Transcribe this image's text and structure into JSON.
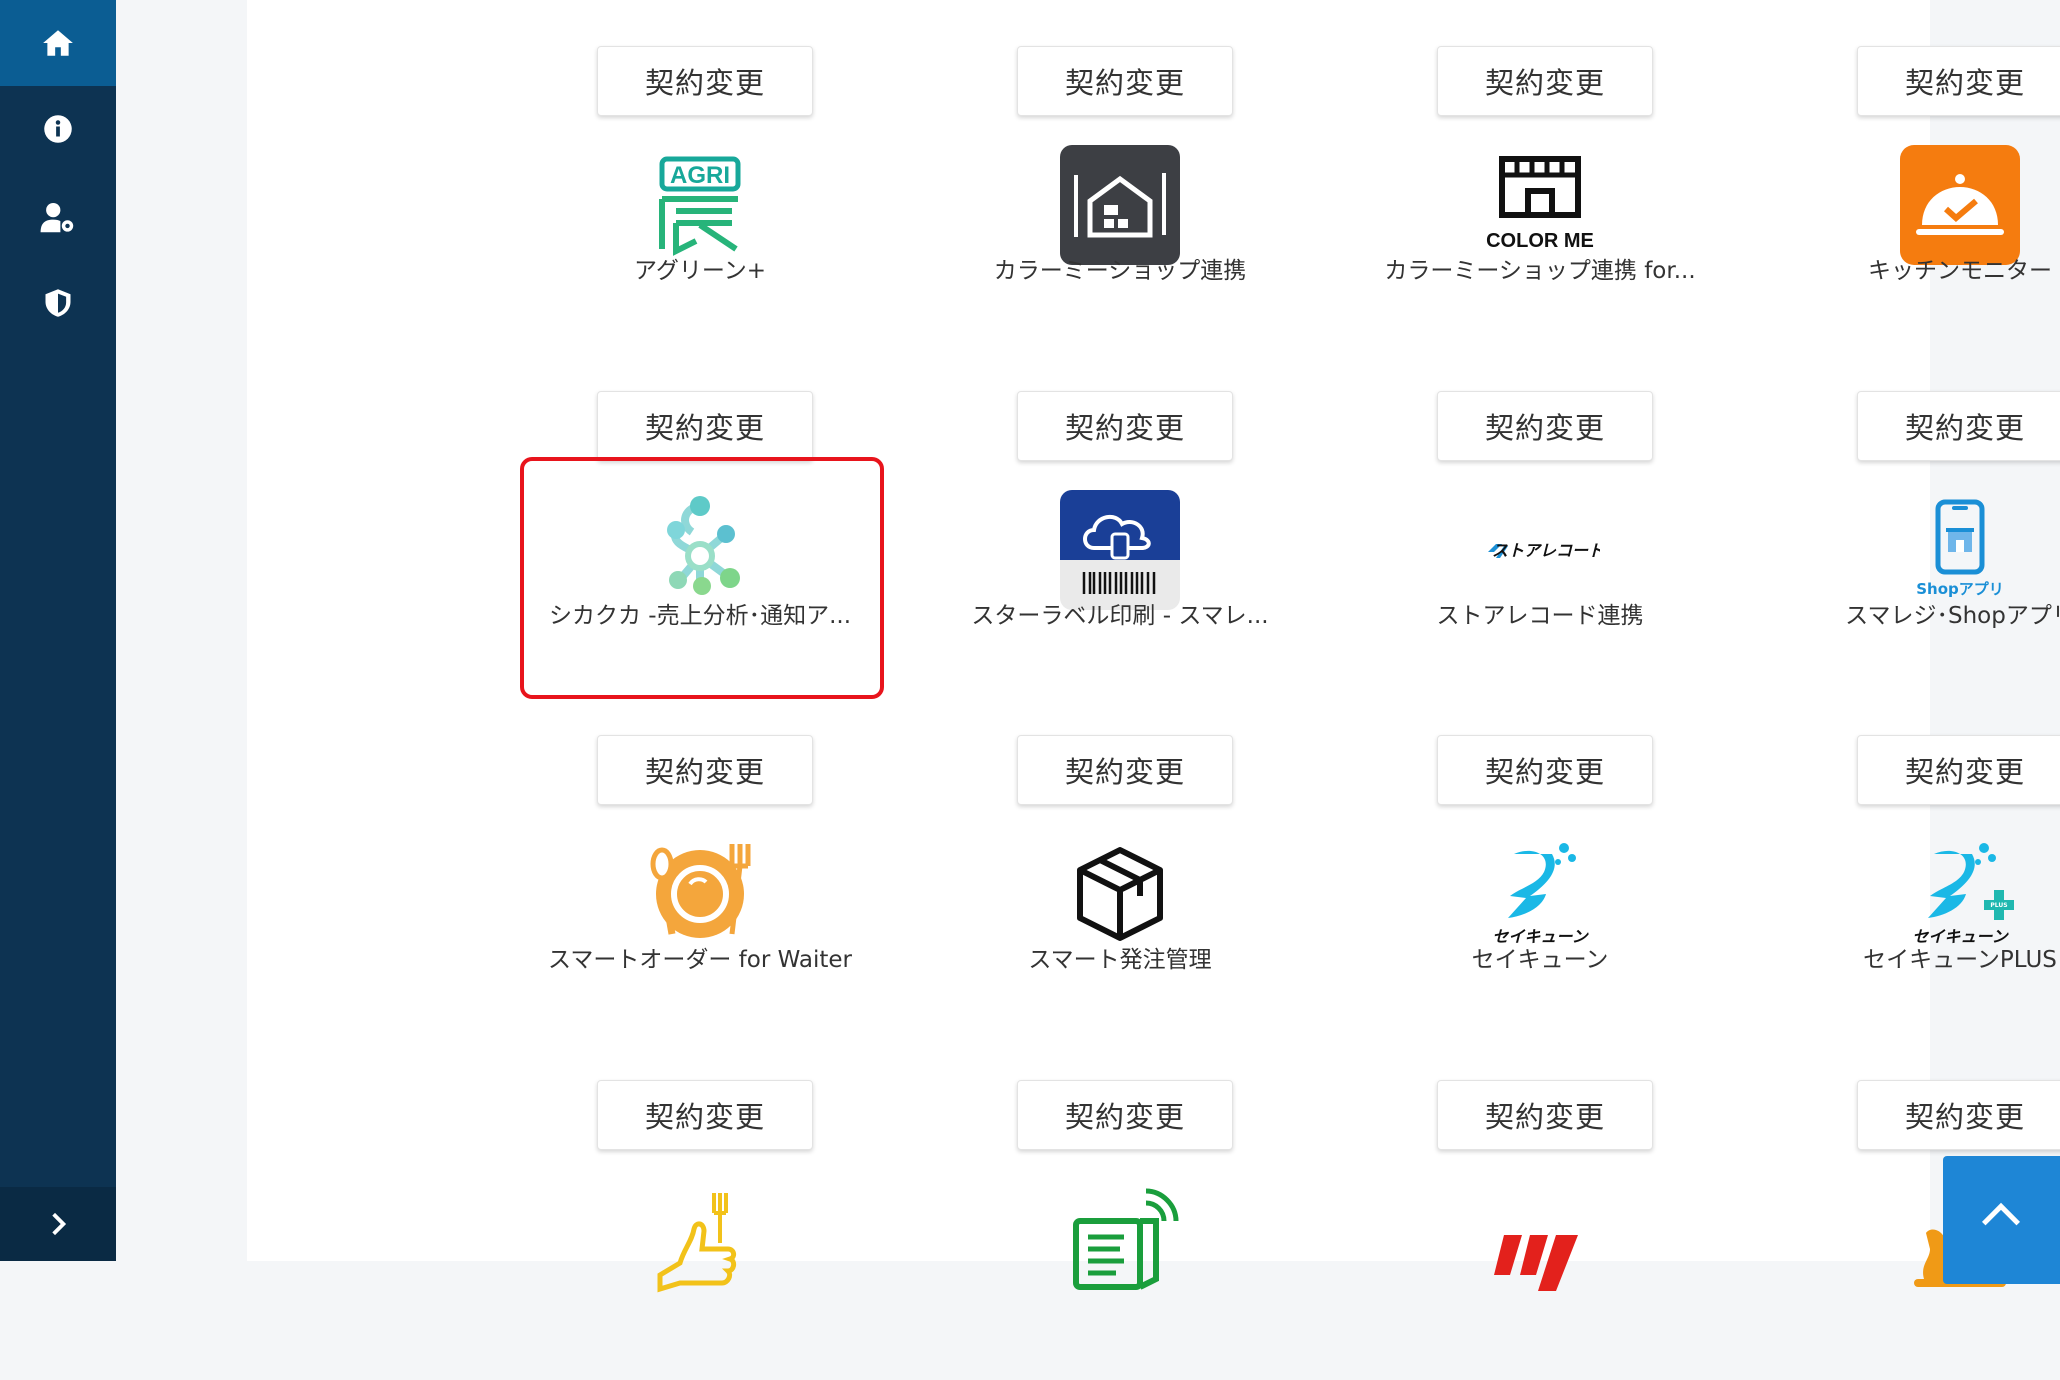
{
  "sidebar": {
    "items": [
      {
        "icon": "home-icon",
        "active": true
      },
      {
        "icon": "info-icon",
        "active": false
      },
      {
        "icon": "user-settings-icon",
        "active": false
      },
      {
        "icon": "shield-icon",
        "active": false
      }
    ],
    "footer_icon": "chevron-right-icon"
  },
  "apps": [
    {
      "button": "契約変更",
      "name": "アグリーン+",
      "logo_text": "AGRI"
    },
    {
      "button": "契約変更",
      "name": "カラーミーショップ連携"
    },
    {
      "button": "契約変更",
      "name": "カラーミーショップ連携 for...",
      "logo_text": "COLOR ME"
    },
    {
      "button": "契約変更",
      "name": "キッチンモニター"
    },
    {
      "button": "契約変更",
      "name": "シカクカ -売上分析･通知ア..."
    },
    {
      "button": "契約変更",
      "name": "スターラベル印刷 - スマレ..."
    },
    {
      "button": "契約変更",
      "name": "ストアレコード連携",
      "logo_text": "ストアレコード"
    },
    {
      "button": "契約変更",
      "name": "スマレジ･Shopアプリ",
      "logo_text": "Shopアプリ"
    },
    {
      "button": "契約変更",
      "name": "スマートオーダー for Waiter"
    },
    {
      "button": "契約変更",
      "name": "スマート発注管理"
    },
    {
      "button": "契約変更",
      "name": "セイキューン",
      "logo_text": "セイキューン"
    },
    {
      "button": "契約変更",
      "name": "セイキューンPLUS",
      "logo_text": "セイキューン",
      "logo_badge": "PLUS"
    },
    {
      "button": "契約変更"
    },
    {
      "button": "契約変更"
    },
    {
      "button": "契約変更"
    },
    {
      "button": "契約変更"
    }
  ],
  "colors": {
    "sidebar": "#0d3352",
    "sidebar_active": "#0b5d93",
    "highlight": "#e8141c",
    "scroll_top": "#1e86d6"
  },
  "scroll_top_icon": "chevron-up-icon"
}
